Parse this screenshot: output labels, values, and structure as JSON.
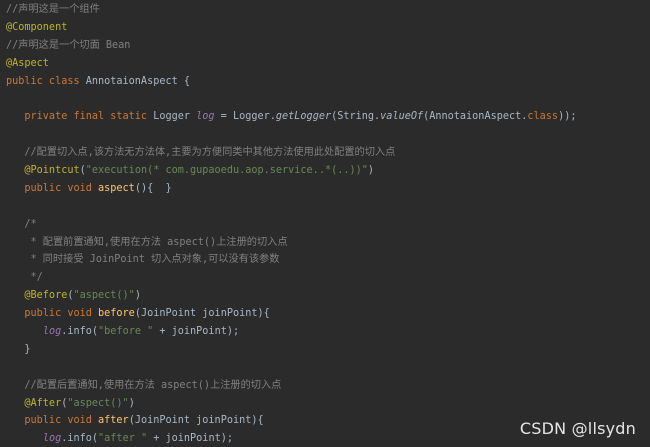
{
  "editor": {
    "background": "#2b2b2b",
    "token_colors": {
      "comment": "#808080",
      "annotation": "#bbb529",
      "keyword": "#cc7832",
      "string": "#6a8759",
      "field": "#9876aa",
      "method": "#ffc66d",
      "plain": "#a9b7c6"
    },
    "lines": [
      [
        {
          "t": "//声明这是一个组件",
          "k": "comment"
        }
      ],
      [
        {
          "t": "@Component",
          "k": "annotation"
        }
      ],
      [
        {
          "t": "//声明这是一个切面 Bean",
          "k": "comment"
        }
      ],
      [
        {
          "t": "@Aspect",
          "k": "annotation"
        }
      ],
      [
        {
          "t": "public class ",
          "k": "keyword"
        },
        {
          "t": "AnnotaionAspect {",
          "k": "plain"
        }
      ],
      [],
      [
        {
          "t": "   private final static ",
          "k": "keyword"
        },
        {
          "t": "Logger ",
          "k": "plain"
        },
        {
          "t": "log",
          "k": "field"
        },
        {
          "t": " = Logger.",
          "k": "plain"
        },
        {
          "t": "getLogger",
          "k": "static-call"
        },
        {
          "t": "(String.",
          "k": "plain"
        },
        {
          "t": "valueOf",
          "k": "static-call"
        },
        {
          "t": "(AnnotaionAspect.",
          "k": "plain"
        },
        {
          "t": "class",
          "k": "keyword"
        },
        {
          "t": "));",
          "k": "plain"
        }
      ],
      [],
      [
        {
          "t": "   //配置切入点,该方法无方法体,主要为方便同类中其他方法使用此处配置的切入点",
          "k": "comment"
        }
      ],
      [
        {
          "t": "   @Pointcut",
          "k": "annotation"
        },
        {
          "t": "(",
          "k": "plain"
        },
        {
          "t": "\"execution(* com.gupaoedu.aop.service..*(..))\"",
          "k": "string"
        },
        {
          "t": ")",
          "k": "plain"
        }
      ],
      [
        {
          "t": "   public void ",
          "k": "keyword"
        },
        {
          "t": "aspect",
          "k": "method"
        },
        {
          "t": "(){  }",
          "k": "plain"
        }
      ],
      [],
      [
        {
          "t": "   /*",
          "k": "comment"
        }
      ],
      [
        {
          "t": "    * 配置前置通知,使用在方法 aspect()上注册的切入点",
          "k": "comment"
        }
      ],
      [
        {
          "t": "    * 同时接受 JoinPoint 切入点对象,可以没有该参数",
          "k": "comment"
        }
      ],
      [
        {
          "t": "    */",
          "k": "comment"
        }
      ],
      [
        {
          "t": "   @Before",
          "k": "annotation"
        },
        {
          "t": "(",
          "k": "plain"
        },
        {
          "t": "\"aspect()\"",
          "k": "string"
        },
        {
          "t": ")",
          "k": "plain"
        }
      ],
      [
        {
          "t": "   public void ",
          "k": "keyword"
        },
        {
          "t": "before",
          "k": "method"
        },
        {
          "t": "(JoinPoint joinPoint){",
          "k": "plain"
        }
      ],
      [
        {
          "t": "      ",
          "k": "plain"
        },
        {
          "t": "log",
          "k": "field"
        },
        {
          "t": ".info(",
          "k": "plain"
        },
        {
          "t": "\"before \"",
          "k": "string"
        },
        {
          "t": " + joinPoint);",
          "k": "plain"
        }
      ],
      [
        {
          "t": "   }",
          "k": "plain"
        }
      ],
      [],
      [
        {
          "t": "   //配置后置通知,使用在方法 aspect()上注册的切入点",
          "k": "comment"
        }
      ],
      [
        {
          "t": "   @After",
          "k": "annotation"
        },
        {
          "t": "(",
          "k": "plain"
        },
        {
          "t": "\"aspect()\"",
          "k": "string"
        },
        {
          "t": ")",
          "k": "plain"
        }
      ],
      [
        {
          "t": "   public void ",
          "k": "keyword"
        },
        {
          "t": "after",
          "k": "method"
        },
        {
          "t": "(JoinPoint joinPoint){",
          "k": "plain"
        }
      ],
      [
        {
          "t": "      ",
          "k": "plain"
        },
        {
          "t": "log",
          "k": "field"
        },
        {
          "t": ".info(",
          "k": "plain"
        },
        {
          "t": "\"after \"",
          "k": "string"
        },
        {
          "t": " + joinPoint);",
          "k": "plain"
        }
      ]
    ]
  },
  "watermark": {
    "text": "CSDN @llsydn",
    "color": "#e6e6e6"
  }
}
